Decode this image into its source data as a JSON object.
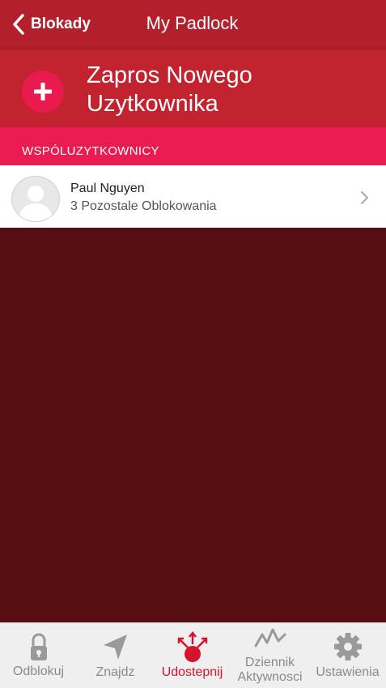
{
  "header": {
    "back_label": "Blokady",
    "title": "My Padlock"
  },
  "invite": {
    "label": "Zapros Nowego Uzytkownika"
  },
  "section": {
    "label": "WSPÓLUZYTKOWNICY"
  },
  "users": [
    {
      "name": "Paul Nguyen",
      "subtitle": "3 Pozostale Oblokowania"
    }
  ],
  "tabs": [
    {
      "label": "Odblokuj",
      "icon": "padlock-icon"
    },
    {
      "label": "Znajdz",
      "icon": "location-arrow-icon"
    },
    {
      "label": "Udostepnij",
      "icon": "share-icon",
      "active": true
    },
    {
      "label": "Dziennik Aktywnosci",
      "icon": "activity-icon"
    },
    {
      "label": "Ustawienia",
      "icon": "gear-icon"
    }
  ],
  "colors": {
    "topbar": "#b41f2c",
    "invite_bg": "#c3232f",
    "accent_pink": "#e91b50",
    "background": "#560e14",
    "active_tab": "#d4132d"
  }
}
